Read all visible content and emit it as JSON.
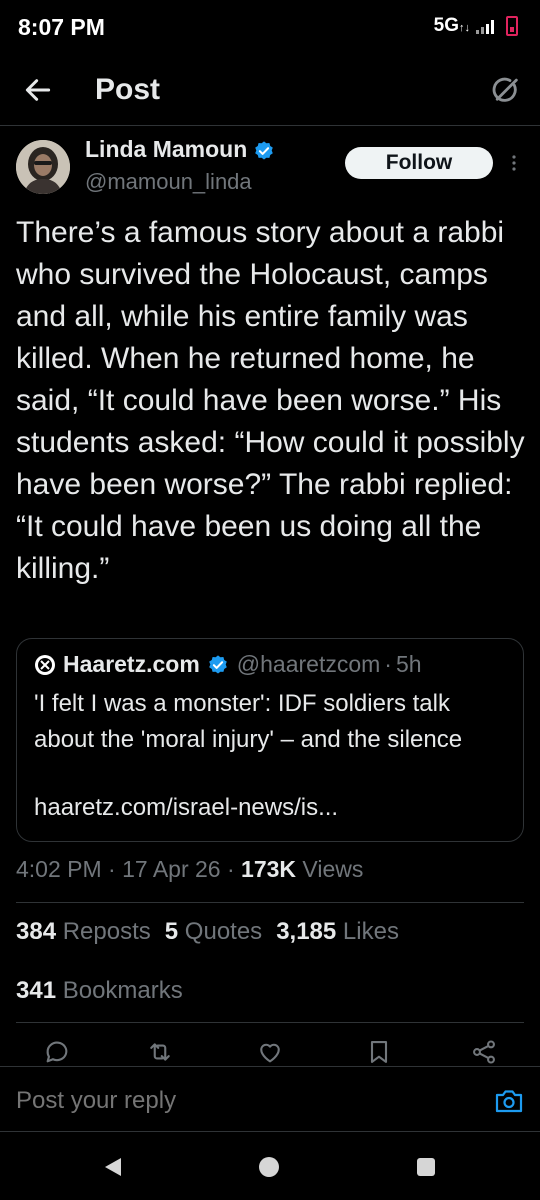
{
  "status_bar": {
    "time": "8:07 PM",
    "network": "5G",
    "network_arrows": "↑↓"
  },
  "header": {
    "title": "Post"
  },
  "author": {
    "name": "Linda Mamoun",
    "handle": "@mamoun_linda",
    "follow_label": "Follow"
  },
  "tweet": {
    "text": "There’s a famous story about a rabbi who survived the Holocaust, camps and all, while his entire family was killed. When he returned home, he said, “It could have been worse.” His students asked: “How could it possibly have been worse?” The rabbi replied: “It could have been us doing all the killing.”"
  },
  "quote": {
    "name": "Haaretz.com",
    "handle": "@haaretzcom",
    "separator": "·",
    "age": "5h",
    "text": "'I felt I was a monster': IDF soldiers talk about the 'moral injury' – and the silence",
    "link": "haaretz.com/israel-news/is..."
  },
  "meta": {
    "time": "4:02 PM",
    "sep": "·",
    "date": "17 Apr 26",
    "views_count": "173K",
    "views_label": "Views"
  },
  "stats": {
    "reposts_count": "384",
    "reposts_label": "Reposts",
    "quotes_count": "5",
    "quotes_label": "Quotes",
    "likes_count": "3,185",
    "likes_label": "Likes",
    "bookmarks_count": "341",
    "bookmarks_label": "Bookmarks"
  },
  "reply": {
    "placeholder": "Post your reply"
  },
  "colors": {
    "background": "#000000",
    "text": "#e7e9ea",
    "muted": "#71767b",
    "border": "#2f3336",
    "accent": "#1d9bf0",
    "battery": "#e0245e"
  },
  "icons": [
    "arrow-left-icon",
    "grok-icon",
    "verified-icon",
    "more-icon",
    "haaretz-logo-icon",
    "reply-icon",
    "repost-icon",
    "like-icon",
    "bookmark-icon",
    "share-icon",
    "camera-icon"
  ]
}
